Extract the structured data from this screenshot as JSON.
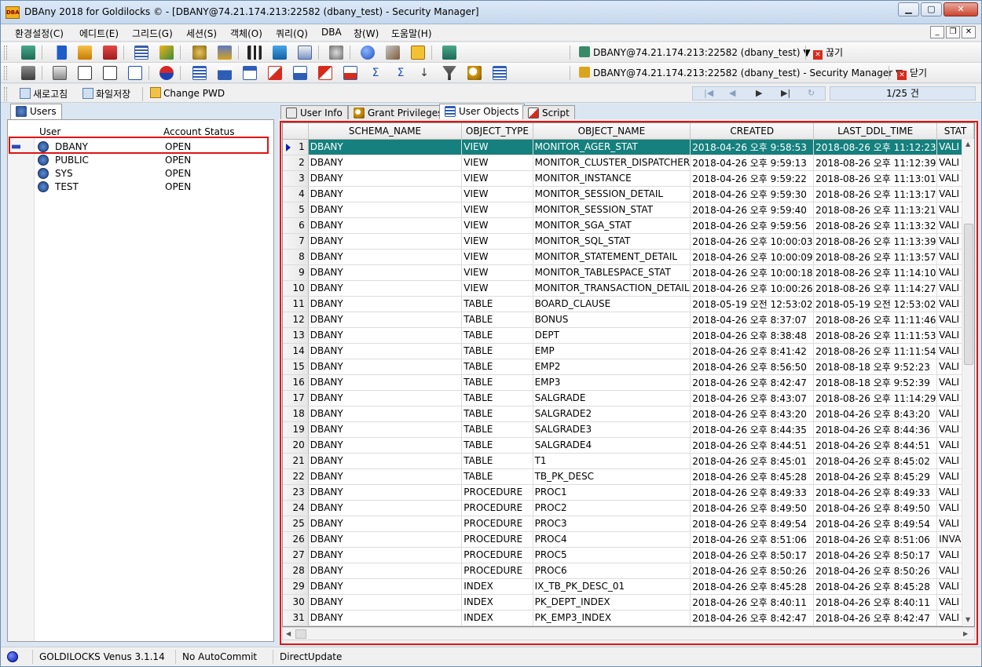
{
  "app": {
    "title": "DBAny 2018 for Goldilocks © - [DBANY@74.21.174.213:22582 (dbany_test) - Security Manager]",
    "icon_text": "DBA"
  },
  "window_buttons": {
    "minimize": "▁",
    "maximize": "▢",
    "close": "✕"
  },
  "menu": {
    "items": [
      "환경설정(C)",
      "에디트(E)",
      "그리드(G)",
      "세션(S)",
      "객체(O)",
      "쿼리(Q)",
      "DBA",
      "창(W)",
      "도움말(H)"
    ],
    "mdi": {
      "minimize": "_",
      "restore": "❐",
      "close": "✕"
    }
  },
  "connections": {
    "conn1": {
      "label": "DBANY@74.21.174.213:22582 (dbany_test) ▼",
      "disconnect": "끊기"
    },
    "conn2": {
      "label": "DBANY@74.21.174.213:22582 (dbany_test) - Security Manager ▼",
      "close": "닫기"
    }
  },
  "subtoolbar": {
    "refresh": "새로고침",
    "save_file": "화일저장",
    "change_pwd": "Change PWD",
    "counter": "1/25 건",
    "nav": {
      "first": "|◀",
      "prev": "◀",
      "next": "▶",
      "last": "▶|",
      "refresh": "↻"
    }
  },
  "left_panel": {
    "tab": "Users",
    "columns": [
      "User",
      "Account Status"
    ],
    "users": [
      {
        "name": "DBANY",
        "status": "OPEN"
      },
      {
        "name": "PUBLIC",
        "status": "OPEN"
      },
      {
        "name": "SYS",
        "status": "OPEN"
      },
      {
        "name": "TEST",
        "status": "OPEN"
      }
    ]
  },
  "right_panel": {
    "tabs": [
      "User Info",
      "Grant Privileges",
      "User Objects",
      "Script"
    ],
    "active_tab": "User Objects",
    "columns": [
      "SCHEMA_NAME",
      "OBJECT_TYPE",
      "OBJECT_NAME",
      "CREATED",
      "LAST_DDL_TIME",
      "STAT"
    ],
    "rows": [
      [
        "1",
        "DBANY",
        "VIEW",
        "MONITOR_AGER_STAT",
        "2018-04-26 오후 9:58:53",
        "2018-08-26 오후 11:12:23",
        "VALI"
      ],
      [
        "2",
        "DBANY",
        "VIEW",
        "MONITOR_CLUSTER_DISPATCHER",
        "2018-04-26 오후 9:59:13",
        "2018-08-26 오후 11:12:39",
        "VALI"
      ],
      [
        "3",
        "DBANY",
        "VIEW",
        "MONITOR_INSTANCE",
        "2018-04-26 오후 9:59:22",
        "2018-08-26 오후 11:13:01",
        "VALI"
      ],
      [
        "4",
        "DBANY",
        "VIEW",
        "MONITOR_SESSION_DETAIL",
        "2018-04-26 오후 9:59:30",
        "2018-08-26 오후 11:13:17",
        "VALI"
      ],
      [
        "5",
        "DBANY",
        "VIEW",
        "MONITOR_SESSION_STAT",
        "2018-04-26 오후 9:59:40",
        "2018-08-26 오후 11:13:21",
        "VALI"
      ],
      [
        "6",
        "DBANY",
        "VIEW",
        "MONITOR_SGA_STAT",
        "2018-04-26 오후 9:59:56",
        "2018-08-26 오후 11:13:32",
        "VALI"
      ],
      [
        "7",
        "DBANY",
        "VIEW",
        "MONITOR_SQL_STAT",
        "2018-04-26 오후 10:00:03",
        "2018-08-26 오후 11:13:39",
        "VALI"
      ],
      [
        "8",
        "DBANY",
        "VIEW",
        "MONITOR_STATEMENT_DETAIL",
        "2018-04-26 오후 10:00:09",
        "2018-08-26 오후 11:13:57",
        "VALI"
      ],
      [
        "9",
        "DBANY",
        "VIEW",
        "MONITOR_TABLESPACE_STAT",
        "2018-04-26 오후 10:00:18",
        "2018-08-26 오후 11:14:10",
        "VALI"
      ],
      [
        "10",
        "DBANY",
        "VIEW",
        "MONITOR_TRANSACTION_DETAIL",
        "2018-04-26 오후 10:00:26",
        "2018-08-26 오후 11:14:27",
        "VALI"
      ],
      [
        "11",
        "DBANY",
        "TABLE",
        "BOARD_CLAUSE",
        "2018-05-19 오전 12:53:02",
        "2018-05-19 오전 12:53:02",
        "VALI"
      ],
      [
        "12",
        "DBANY",
        "TABLE",
        "BONUS",
        "2018-04-26 오후 8:37:07",
        "2018-08-26 오후 11:11:46",
        "VALI"
      ],
      [
        "13",
        "DBANY",
        "TABLE",
        "DEPT",
        "2018-04-26 오후 8:38:48",
        "2018-08-26 오후 11:11:53",
        "VALI"
      ],
      [
        "14",
        "DBANY",
        "TABLE",
        "EMP",
        "2018-04-26 오후 8:41:42",
        "2018-08-26 오후 11:11:54",
        "VALI"
      ],
      [
        "15",
        "DBANY",
        "TABLE",
        "EMP2",
        "2018-04-26 오후 8:56:50",
        "2018-08-18 오후 9:52:23",
        "VALI"
      ],
      [
        "16",
        "DBANY",
        "TABLE",
        "EMP3",
        "2018-04-26 오후 8:42:47",
        "2018-08-18 오후 9:52:39",
        "VALI"
      ],
      [
        "17",
        "DBANY",
        "TABLE",
        "SALGRADE",
        "2018-04-26 오후 8:43:07",
        "2018-08-26 오후 11:14:29",
        "VALI"
      ],
      [
        "18",
        "DBANY",
        "TABLE",
        "SALGRADE2",
        "2018-04-26 오후 8:43:20",
        "2018-04-26 오후 8:43:20",
        "VALI"
      ],
      [
        "19",
        "DBANY",
        "TABLE",
        "SALGRADE3",
        "2018-04-26 오후 8:44:35",
        "2018-04-26 오후 8:44:36",
        "VALI"
      ],
      [
        "20",
        "DBANY",
        "TABLE",
        "SALGRADE4",
        "2018-04-26 오후 8:44:51",
        "2018-04-26 오후 8:44:51",
        "VALI"
      ],
      [
        "21",
        "DBANY",
        "TABLE",
        "T1",
        "2018-04-26 오후 8:45:01",
        "2018-04-26 오후 8:45:02",
        "VALI"
      ],
      [
        "22",
        "DBANY",
        "TABLE",
        "TB_PK_DESC",
        "2018-04-26 오후 8:45:28",
        "2018-04-26 오후 8:45:29",
        "VALI"
      ],
      [
        "23",
        "DBANY",
        "PROCEDURE",
        "PROC1",
        "2018-04-26 오후 8:49:33",
        "2018-04-26 오후 8:49:33",
        "VALI"
      ],
      [
        "24",
        "DBANY",
        "PROCEDURE",
        "PROC2",
        "2018-04-26 오후 8:49:50",
        "2018-04-26 오후 8:49:50",
        "VALI"
      ],
      [
        "25",
        "DBANY",
        "PROCEDURE",
        "PROC3",
        "2018-04-26 오후 8:49:54",
        "2018-04-26 오후 8:49:54",
        "VALI"
      ],
      [
        "26",
        "DBANY",
        "PROCEDURE",
        "PROC4",
        "2018-04-26 오후 8:51:06",
        "2018-04-26 오후 8:51:06",
        "INVA"
      ],
      [
        "27",
        "DBANY",
        "PROCEDURE",
        "PROC5",
        "2018-04-26 오후 8:50:17",
        "2018-04-26 오후 8:50:17",
        "VALI"
      ],
      [
        "28",
        "DBANY",
        "PROCEDURE",
        "PROC6",
        "2018-04-26 오후 8:50:26",
        "2018-04-26 오후 8:50:26",
        "VALI"
      ],
      [
        "29",
        "DBANY",
        "INDEX",
        "IX_TB_PK_DESC_01",
        "2018-04-26 오후 8:45:28",
        "2018-04-26 오후 8:45:28",
        "VALI"
      ],
      [
        "30",
        "DBANY",
        "INDEX",
        "PK_DEPT_INDEX",
        "2018-04-26 오후 8:40:11",
        "2018-04-26 오후 8:40:11",
        "VALI"
      ],
      [
        "31",
        "DBANY",
        "INDEX",
        "PK_EMP3_INDEX",
        "2018-04-26 오후 8:42:47",
        "2018-04-26 오후 8:42:47",
        "VALI"
      ]
    ]
  },
  "statusbar": {
    "server": "GOLDILOCKS Venus 3.1.14",
    "commit": "No AutoCommit",
    "update": "DirectUpdate"
  },
  "colors": {
    "selection": "#15807d",
    "highlight_border": "#e01414",
    "accent": "#2b5797"
  }
}
